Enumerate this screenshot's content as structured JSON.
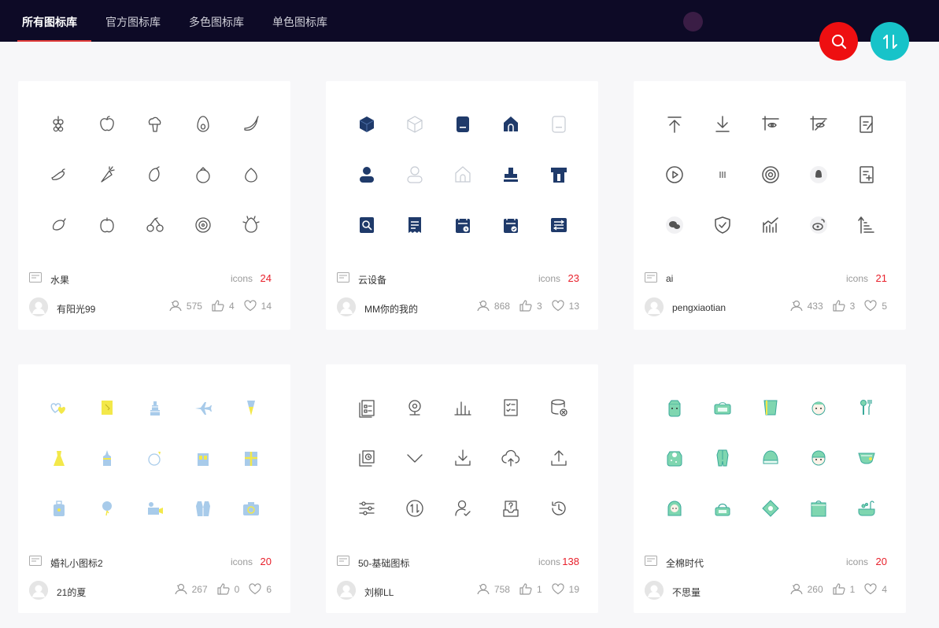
{
  "nav": {
    "tabs": [
      {
        "label": "所有图标库",
        "active": true
      },
      {
        "label": "官方图标库",
        "active": false
      },
      {
        "label": "多色图标库",
        "active": false
      },
      {
        "label": "单色图标库",
        "active": false
      }
    ]
  },
  "actions": {
    "search_icon": "search-icon",
    "sort_icon": "sort-icon"
  },
  "colors": {
    "accent": "#e8202b",
    "search_button": "#ee0f11",
    "sort_button": "#17c3c9",
    "topbar": "#0d0a26"
  },
  "cards": [
    {
      "name": "水果",
      "icons_label": "icons",
      "count": "24",
      "user": "有阳光99",
      "views": "575",
      "likes": "4",
      "favorites": "14",
      "icon_style": "fruit-outline-icons",
      "icon_names": [
        "grapes-icon",
        "apple-icon",
        "broccoli-icon",
        "avocado-icon",
        "banana-icon",
        "pepper-icon",
        "carrot-icon",
        "mango-icon",
        "pomegranate-icon",
        "peach-icon",
        "lemon-icon",
        "orange-icon",
        "cherry-icon",
        "kiwi-icon",
        "dragonfruit-icon"
      ]
    },
    {
      "name": "云设备",
      "icons_label": "icons",
      "count": "23",
      "user": "MM你的我的",
      "views": "868",
      "likes": "3",
      "favorites": "13",
      "icon_style": "navy-filled-icons",
      "icon_names": [
        "cube-icon",
        "cube-outline-icon",
        "sim-icon",
        "home-icon",
        "card-icon",
        "user-icon",
        "user-outline-icon",
        "home-outline-icon",
        "stamp-icon",
        "gate-icon",
        "search-doc-icon",
        "receipt-icon",
        "calendar-clock-icon",
        "calendar-check-icon",
        "settings-list-icon"
      ]
    },
    {
      "name": "ai",
      "icons_label": "icons",
      "count": "21",
      "user": "pengxiaotian",
      "views": "433",
      "likes": "3",
      "favorites": "5",
      "icon_style": "gray-outline-icons",
      "icon_names": [
        "upload-top-icon",
        "download-icon",
        "crop-eye-icon",
        "crop-hide-icon",
        "notes-icon",
        "play-icon",
        "bars-icon",
        "target-icon",
        "qq-icon",
        "doc-add-icon",
        "wechat-icon",
        "shield-check-icon",
        "trend-chart-icon",
        "weibo-icon",
        "sort-asc-icon"
      ]
    },
    {
      "name": "婚礼小图标2",
      "icons_label": "icons",
      "count": "20",
      "user": "21的夏",
      "views": "267",
      "likes": "0",
      "favorites": "6",
      "icon_style": "wedding-color-icons",
      "icon_names": [
        "hearts-icon",
        "card-icon",
        "cake-icon",
        "plane-icon",
        "bouquet-icon",
        "dress-icon",
        "castle-icon",
        "ring-icon",
        "building-icon",
        "gift-icon",
        "suitcase-icon",
        "balloon-icon",
        "camera-video-icon",
        "suit-icon",
        "photo-camera-icon"
      ]
    },
    {
      "name": "50-基础图标",
      "icons_label": "icons",
      "count": "138",
      "user": "刘柳LL",
      "views": "758",
      "likes": "1",
      "favorites": "19",
      "icon_style": "basic-outline-icons",
      "icon_names": [
        "checklist-icon",
        "webcam-icon",
        "bar-chart-icon",
        "list-check-icon",
        "database-x-icon",
        "history-copy-icon",
        "chevron-down-icon",
        "download-icon",
        "cloud-upload-icon",
        "upload-icon",
        "sliders-icon",
        "swap-icon",
        "user-check-icon",
        "question-inbox-icon",
        "history-icon"
      ]
    },
    {
      "name": "全棉时代",
      "icons_label": "icons",
      "count": "20",
      "user": "不思量",
      "views": "260",
      "likes": "1",
      "favorites": "4",
      "icon_style": "baby-color-icons",
      "icon_names": [
        "baby-face-icon",
        "tissue-box-icon",
        "towel-icon",
        "baby-head-icon",
        "utensils-icon",
        "bib-icon",
        "romper-icon",
        "baby-hat-icon",
        "kid-face-icon",
        "diaper-icon",
        "girl-icon",
        "bag-icon",
        "pillow-icon",
        "wipes-icon",
        "bath-icon"
      ]
    }
  ]
}
